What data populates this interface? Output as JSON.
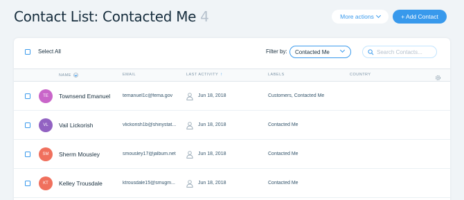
{
  "header": {
    "title": "Contact List: Contacted Me",
    "count": "4",
    "more_actions_label": "More actions",
    "add_contact_label": "+ Add Contact"
  },
  "toolbar": {
    "select_all_label": "Select All",
    "filter_label": "Filter by:",
    "filter_value": "Contacted Me",
    "search_placeholder": "Search Contacts..."
  },
  "table": {
    "columns": [
      "NAME",
      "EMAIL",
      "LAST ACTIVITY",
      "LABELS",
      "COUNTRY"
    ],
    "rows": [
      {
        "initials": "TE",
        "avatar_color": "#c965c9",
        "name": "Townsend Emanuel",
        "email": "temanuel1c@fema.gov",
        "last_activity": "Jun 18, 2018",
        "labels": "Customers, Contacted Me",
        "country": ""
      },
      {
        "initials": "VL",
        "avatar_color": "#9262c2",
        "name": "Vail Lickorish",
        "email": "vlickorish1b@shinystat...",
        "last_activity": "Jun 18, 2018",
        "labels": "Contacted Me",
        "country": ""
      },
      {
        "initials": "SM",
        "avatar_color": "#f0705d",
        "name": "Sherm Mousley",
        "email": "smousley17@jalbum.net",
        "last_activity": "Jun 18, 2018",
        "labels": "Contacted Me",
        "country": ""
      },
      {
        "initials": "KT",
        "avatar_color": "#f0705d",
        "name": "Kelley Trousdale",
        "email": "ktrousdale15@smugm...",
        "last_activity": "Jun 18, 2018",
        "labels": "Contacted Me",
        "country": ""
      }
    ]
  },
  "colors": {
    "accent": "#3899ec",
    "background": "#f0f4f7",
    "text_dark": "#162d3d"
  },
  "icons": [
    "chevron-down-icon",
    "search-icon",
    "sort-icon",
    "gear-icon",
    "person-icon"
  ]
}
